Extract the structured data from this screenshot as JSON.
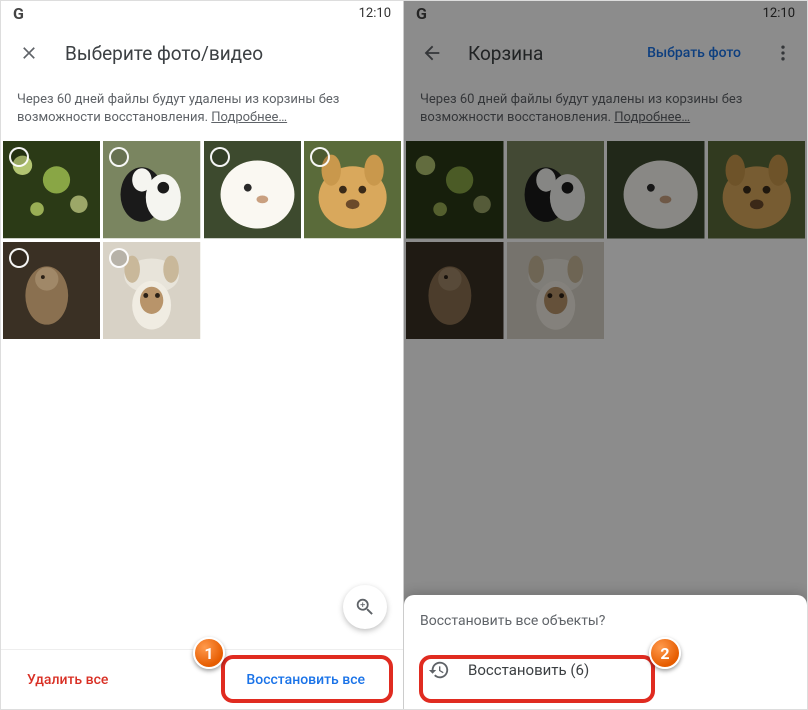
{
  "status": {
    "logo": "G",
    "time": "12:10"
  },
  "left": {
    "title": "Выберите фото/видео",
    "notice": "Через 60 дней файлы будут удалены из корзины без возможности восстановления.",
    "more": "Подробнее…",
    "delete_all": "Удалить все",
    "restore_all": "Восстановить все"
  },
  "right": {
    "title": "Корзина",
    "select_photo": "Выбрать фото",
    "notice": "Через 60 дней файлы будут удалены из корзины без возможности восстановления.",
    "more": "Подробнее…",
    "sheet_title": "Восстановить все объекты?",
    "sheet_action": "Восстановить (6)"
  },
  "steps": {
    "one": "1",
    "two": "2"
  },
  "thumbs": [
    {
      "name": "bokeh-green"
    },
    {
      "name": "border-collie-pair"
    },
    {
      "name": "white-puppy"
    },
    {
      "name": "golden-retriever"
    },
    {
      "name": "monkey"
    },
    {
      "name": "dog-hat"
    }
  ]
}
